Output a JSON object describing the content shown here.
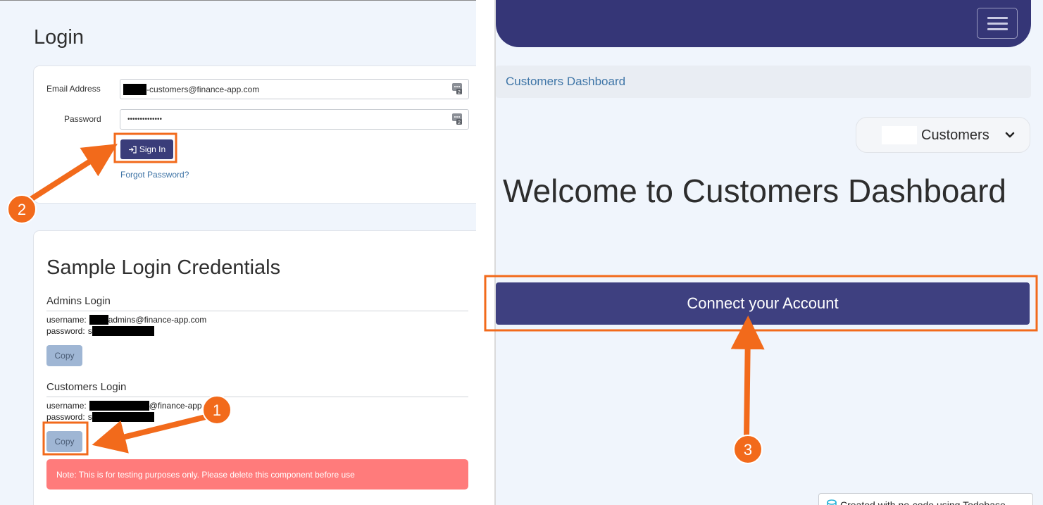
{
  "left_panel": {
    "page_title": "Login",
    "login_form": {
      "email_label": "Email Address",
      "email_value": "-customers@finance-app.com",
      "password_label": "Password",
      "password_value": "••••••••••••••",
      "sign_in_label": "Sign In",
      "forgot_password": "Forgot Password?"
    },
    "credentials": {
      "title": "Sample Login Credentials",
      "admins": {
        "heading": "Admins Login",
        "username_label": "username:",
        "username_value": "admins@finance-app.com",
        "password_label": "password:",
        "password_value": "s",
        "copy_label": "Copy"
      },
      "customers": {
        "heading": "Customers Login",
        "username_label": "username:",
        "username_value": "@finance-app",
        "password_label": "password:",
        "password_value": "s",
        "copy_label": "Copy"
      },
      "note": "Note: This is for testing purposes only. Please delete this component before use"
    }
  },
  "right_panel": {
    "breadcrumb": "Customers Dashboard",
    "role_dropdown": "Customers",
    "welcome_heading": "Welcome to Customers Dashboard",
    "connect_button": "Connect your Account",
    "footer_badge": "Created with no-code using Todobase"
  },
  "annotations": {
    "step_1": "1",
    "step_2": "2",
    "step_3": "3",
    "accent_color": "#f26a1b"
  },
  "colors": {
    "primary": "#3a3d7a",
    "navbar": "#353677",
    "link": "#3e75a7",
    "note_background": "#ff7b7b",
    "copy_button": "#9fb6d4",
    "page_background": "#f0f5fc"
  }
}
